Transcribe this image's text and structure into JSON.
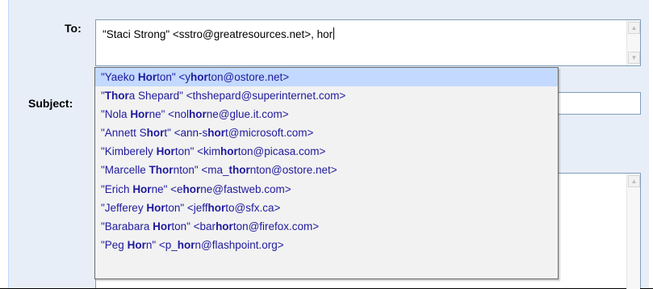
{
  "labels": {
    "to": "To:",
    "subject": "Subject:"
  },
  "to_field": {
    "value": "\"Staci Strong\" <sstro@greatresources.net>, hor"
  },
  "subject_field": {
    "value": ""
  },
  "autocomplete": {
    "selected_index": 0,
    "items": [
      [
        [
          "\"Yaeko ",
          false
        ],
        [
          "Hor",
          true
        ],
        [
          "ton\" <y",
          false
        ],
        [
          "hor",
          true
        ],
        [
          "ton@ostore.net>",
          false
        ]
      ],
      [
        [
          "\"",
          false
        ],
        [
          "Thor",
          true
        ],
        [
          "a Shepard\" <thshepard@superinternet.com>",
          false
        ]
      ],
      [
        [
          "\"Nola ",
          false
        ],
        [
          "Hor",
          true
        ],
        [
          "ne\" <nol",
          false
        ],
        [
          "hor",
          true
        ],
        [
          "ne@glue.it.com>",
          false
        ]
      ],
      [
        [
          "\"Annett S",
          false
        ],
        [
          "hor",
          true
        ],
        [
          "t\" <ann-s",
          false
        ],
        [
          "hor",
          true
        ],
        [
          "t@microsoft.com>",
          false
        ]
      ],
      [
        [
          "\"Kimberely ",
          false
        ],
        [
          "Hor",
          true
        ],
        [
          "ton\" <kim",
          false
        ],
        [
          "hor",
          true
        ],
        [
          "ton@picasa.com>",
          false
        ]
      ],
      [
        [
          "\"Marcelle ",
          false
        ],
        [
          "Thor",
          true
        ],
        [
          "nton\" <ma_",
          false
        ],
        [
          "thor",
          true
        ],
        [
          "nton@ostore.net>",
          false
        ]
      ],
      [
        [
          "\"Erich ",
          false
        ],
        [
          "Hor",
          true
        ],
        [
          "ne\" <e",
          false
        ],
        [
          "hor",
          true
        ],
        [
          "ne@fastweb.com>",
          false
        ]
      ],
      [
        [
          "\"Jefferey ",
          false
        ],
        [
          "Hor",
          true
        ],
        [
          "ton\" <jeff",
          false
        ],
        [
          "hor",
          true
        ],
        [
          "to@sfx.ca>",
          false
        ]
      ],
      [
        [
          "\"Barabara ",
          false
        ],
        [
          "Hor",
          true
        ],
        [
          "ton\" <bar",
          false
        ],
        [
          "hor",
          true
        ],
        [
          "ton@firefox.com>",
          false
        ]
      ],
      [
        [
          "\"Peg ",
          false
        ],
        [
          "Hor",
          true
        ],
        [
          "n\" <p_",
          false
        ],
        [
          "hor",
          true
        ],
        [
          "n@flashpoint.org>",
          false
        ]
      ]
    ]
  },
  "colors": {
    "panel": "#e8eef7",
    "suggestion_text": "#1f1a9c",
    "selected_row": "#c3d9ff"
  }
}
